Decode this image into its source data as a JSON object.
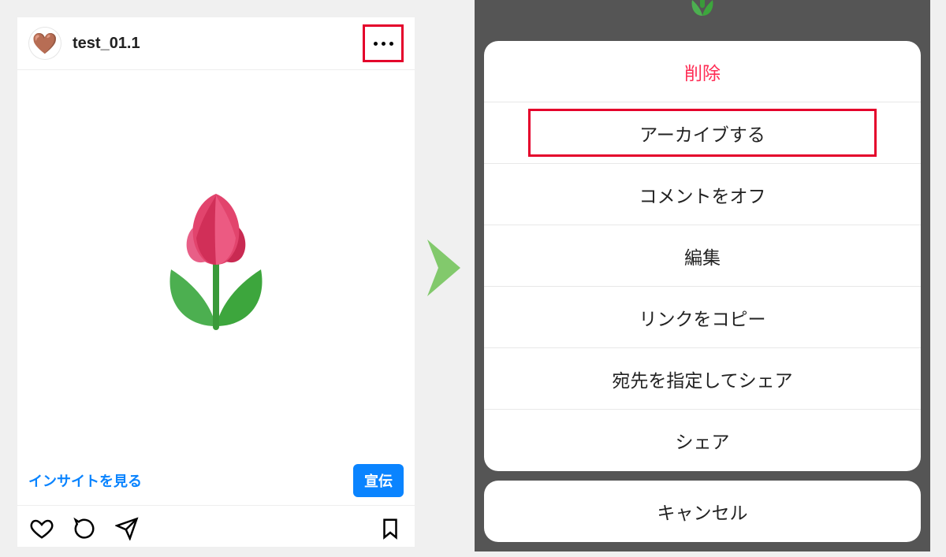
{
  "post": {
    "username": "test_01.1",
    "avatar_emoji": "🤎",
    "image_emoji_name": "tulip",
    "insights_label": "インサイトを見る",
    "promote_label": "宣伝"
  },
  "icons": {
    "more": "more-options-icon",
    "like": "heart-icon",
    "comment": "comment-icon",
    "share": "send-icon",
    "save": "bookmark-icon"
  },
  "action_sheet": {
    "items": [
      {
        "label": "削除",
        "style": "delete"
      },
      {
        "label": "アーカイブする",
        "style": "highlight"
      },
      {
        "label": "コメントをオフ",
        "style": ""
      },
      {
        "label": "編集",
        "style": ""
      },
      {
        "label": "リンクをコピー",
        "style": ""
      },
      {
        "label": "宛先を指定してシェア",
        "style": ""
      },
      {
        "label": "シェア",
        "style": ""
      }
    ],
    "cancel_label": "キャンセル"
  }
}
